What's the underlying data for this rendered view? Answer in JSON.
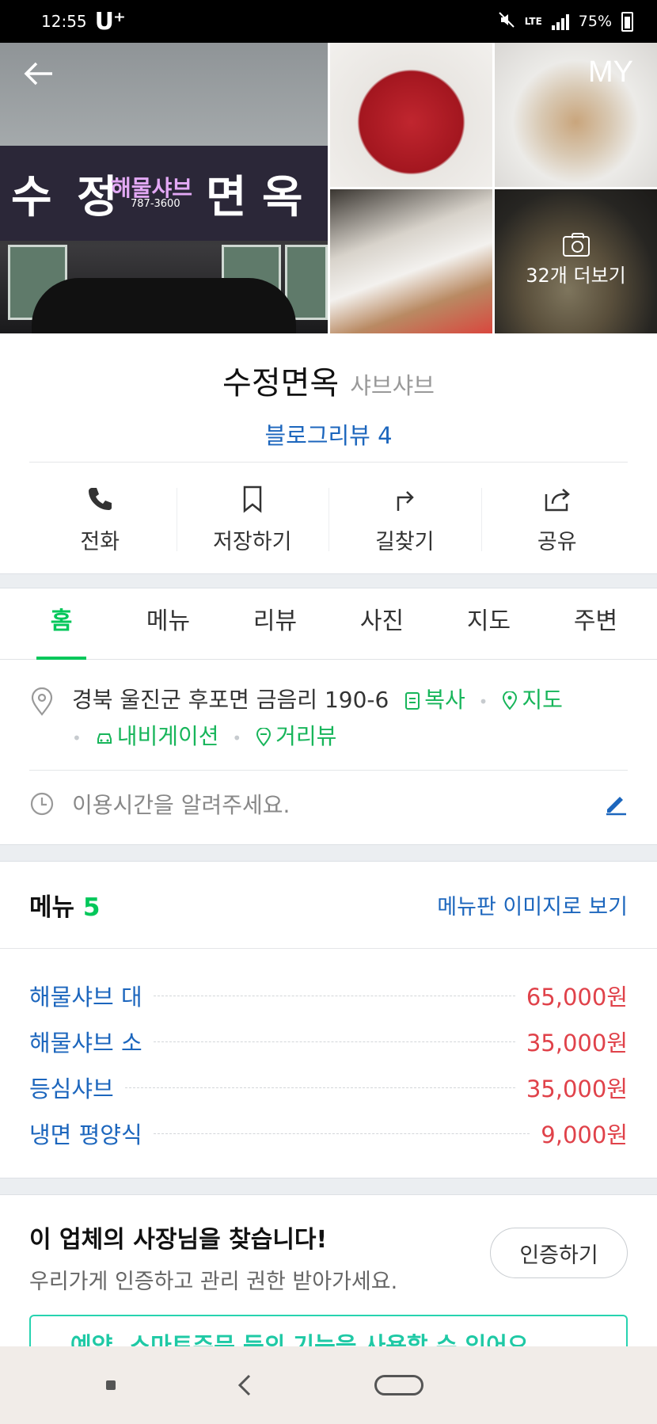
{
  "status_bar": {
    "time": "12:55",
    "carrier": "U⁺",
    "network": "LTE",
    "battery": "75%"
  },
  "header": {
    "back_icon": "arrow-left-icon",
    "my_label": "MY"
  },
  "gallery": {
    "more_label": "32개 더보기",
    "more_icon": "camera-icon",
    "sign": {
      "main": "수 정",
      "sub": "해물샤브",
      "main2": "면 옥",
      "phone": "787-3600"
    }
  },
  "place": {
    "name": "수정면옥",
    "category": "샤브샤브",
    "blog_review": "블로그리뷰 4"
  },
  "actions": [
    {
      "label": "전화",
      "icon": "phone-icon"
    },
    {
      "label": "저장하기",
      "icon": "bookmark-icon"
    },
    {
      "label": "길찾기",
      "icon": "directions-icon"
    },
    {
      "label": "공유",
      "icon": "share-icon"
    }
  ],
  "tabs": [
    {
      "label": "홈",
      "active": true
    },
    {
      "label": "메뉴"
    },
    {
      "label": "리뷰"
    },
    {
      "label": "사진"
    },
    {
      "label": "지도"
    },
    {
      "label": "주변"
    }
  ],
  "info": {
    "address": "경북 울진군 후포면 금음리 190-6",
    "copy_label": "복사",
    "map_label": "지도",
    "navigation_label": "내비게이션",
    "streetview_label": "거리뷰",
    "hours_placeholder": "이용시간을 알려주세요."
  },
  "menu": {
    "title": "메뉴",
    "count": "5",
    "view_image_link": "메뉴판 이미지로 보기",
    "items": [
      {
        "name": "해물샤브 대",
        "price": "65,000원"
      },
      {
        "name": "해물샤브 소",
        "price": "35,000원"
      },
      {
        "name": "등심샤브",
        "price": "35,000원"
      },
      {
        "name": "냉면 평양식",
        "price": "9,000원"
      }
    ]
  },
  "owner": {
    "title": "이 업체의 사장님을 찾습니다!",
    "subtitle": "우리가게 인증하고 관리 권한 받아가세요.",
    "verify_button": "인증하기",
    "promo_text": "예약, 스마트주문 등의 기능을 사용할 수 있어요"
  },
  "colors": {
    "accent_green": "#03c75a",
    "link_blue": "#1c66bd",
    "price_red": "#e0424a"
  }
}
